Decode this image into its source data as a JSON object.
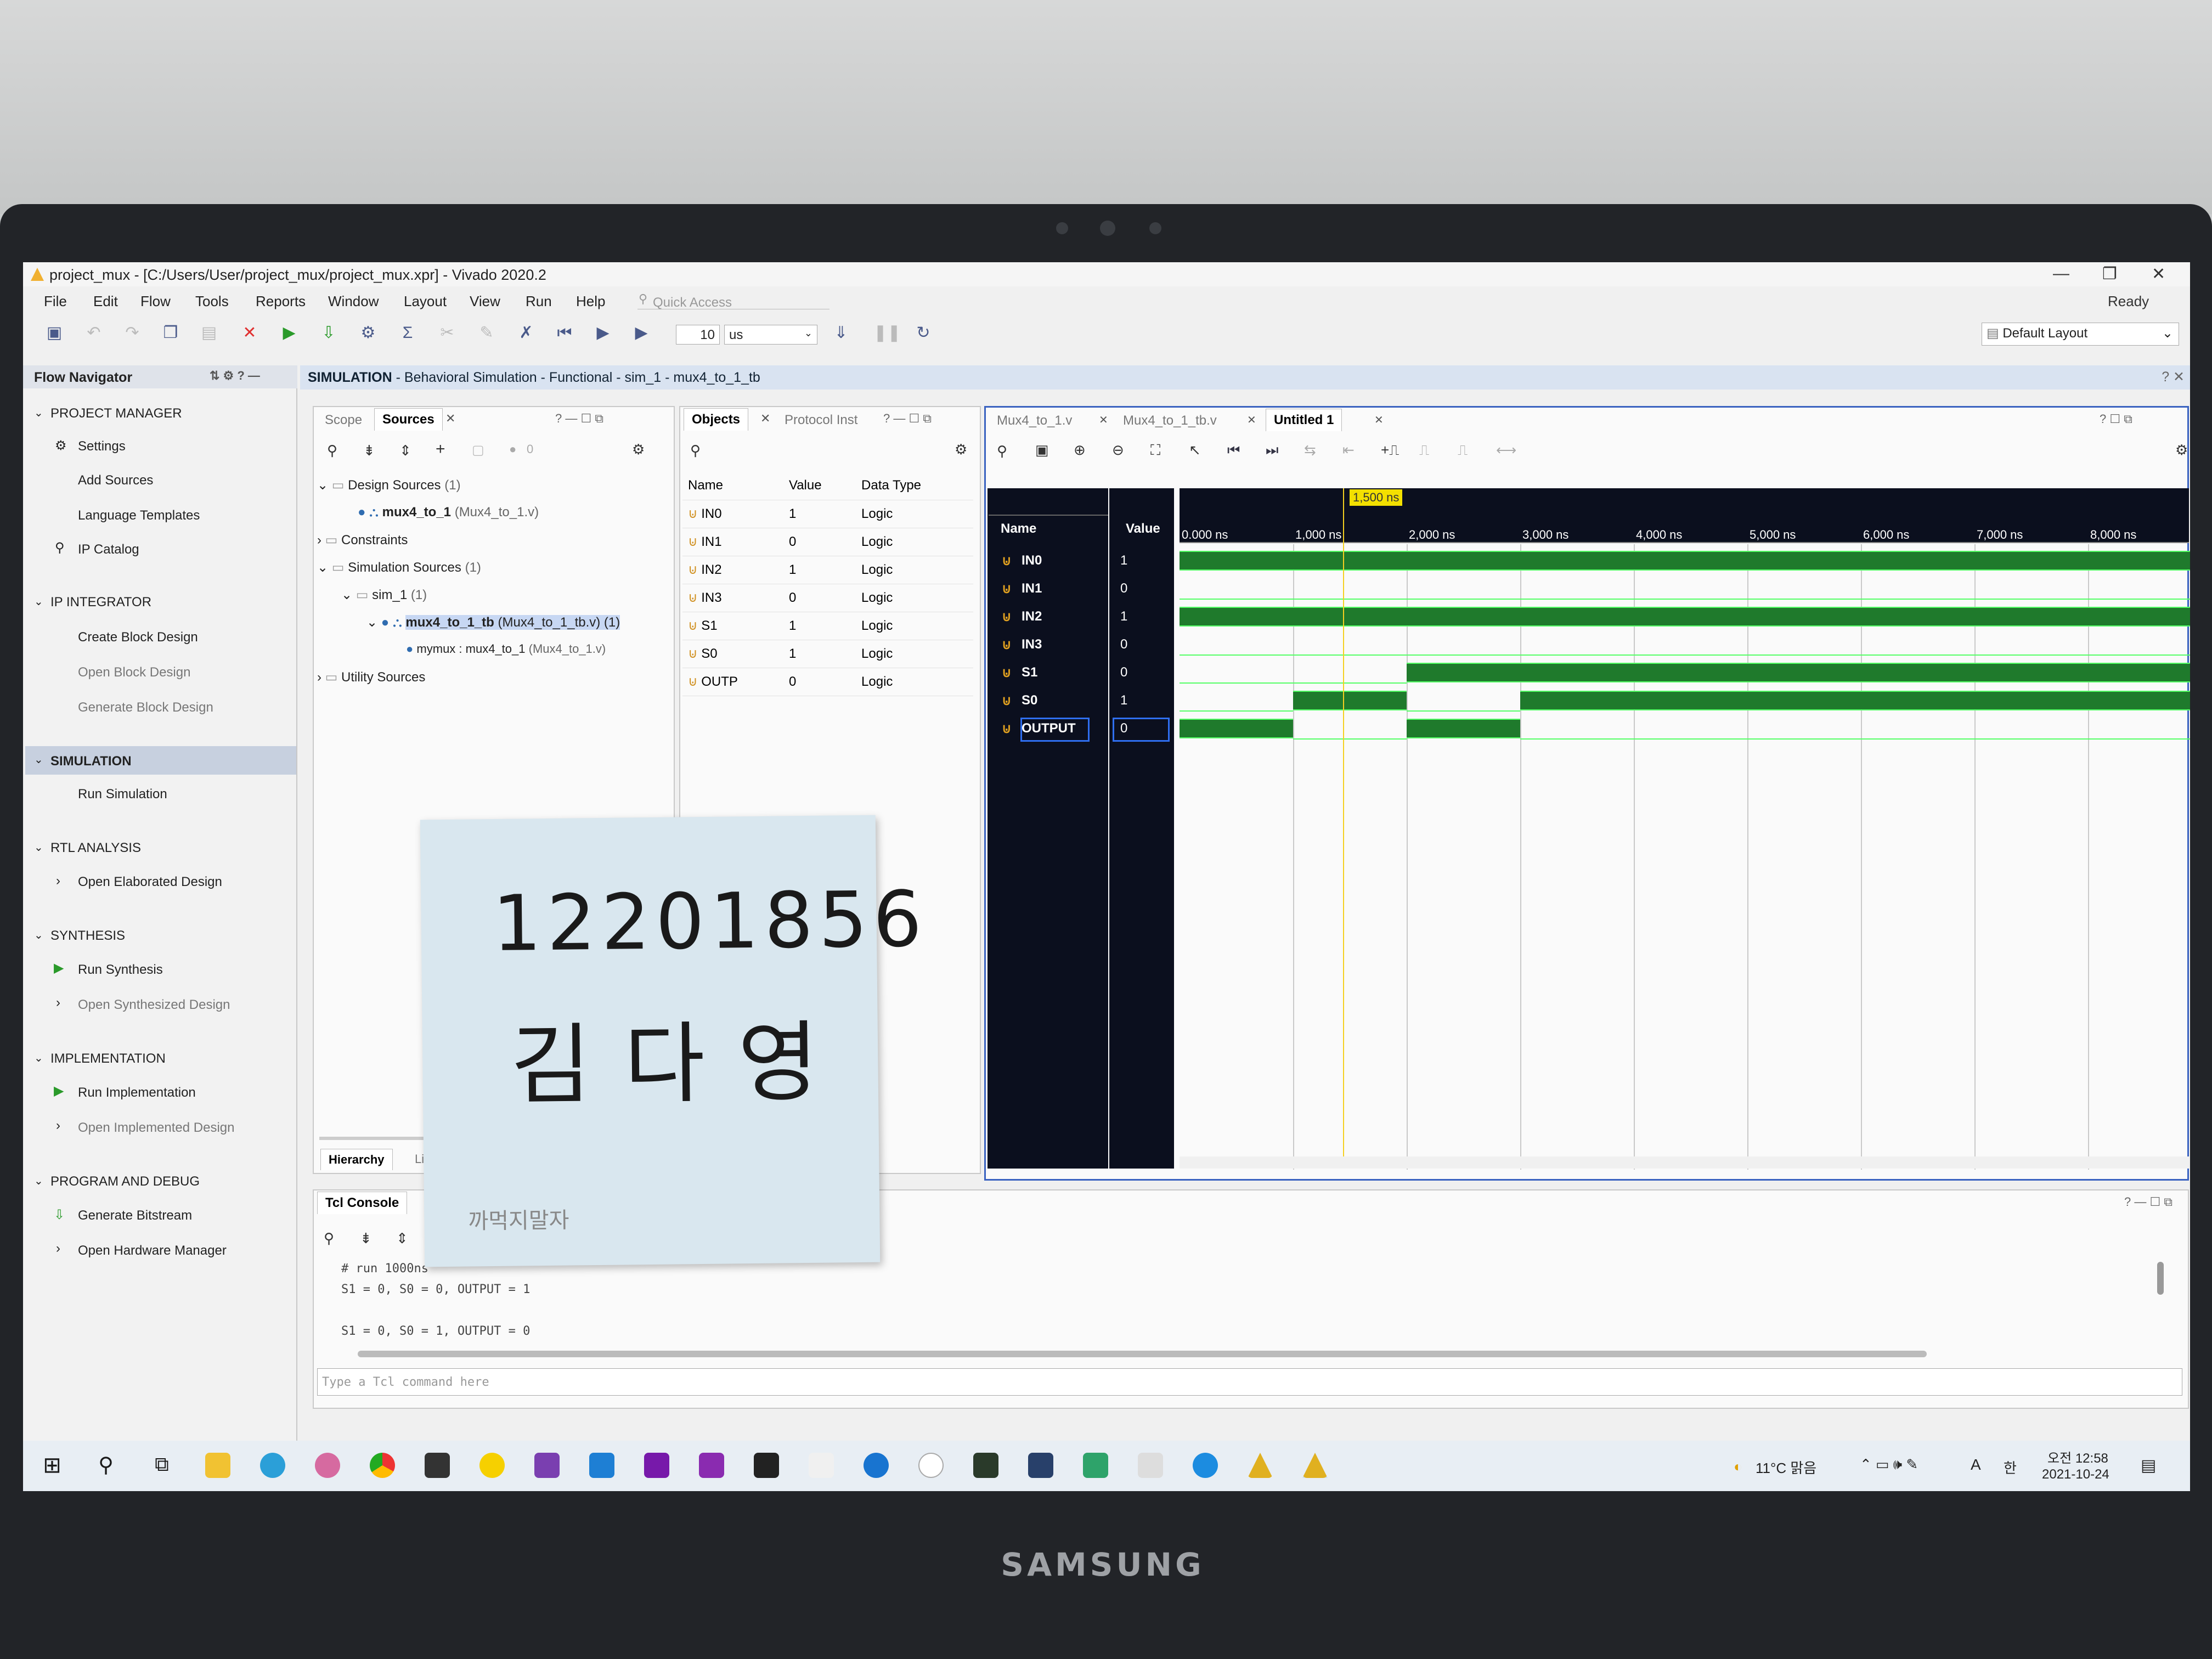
{
  "window": {
    "title": "project_mux - [C:/Users/User/project_mux/project_mux.xpr] - Vivado 2020.2",
    "status": "Ready",
    "controls": [
      "—",
      "❐",
      "✕"
    ]
  },
  "menu": [
    "File",
    "Edit",
    "Flow",
    "Tools",
    "Reports",
    "Window",
    "Layout",
    "View",
    "Run",
    "Help"
  ],
  "quick_access_placeholder": "Quick Access",
  "toolbar": {
    "run_time_value": "10",
    "run_time_unit": "us",
    "layout_select": "Default Layout"
  },
  "flow_navigator": {
    "title": "Flow Navigator",
    "sections": [
      {
        "label": "PROJECT MANAGER",
        "items": [
          "Settings",
          "Add Sources",
          "Language Templates",
          "IP Catalog"
        ]
      },
      {
        "label": "IP INTEGRATOR",
        "items": [
          "Create Block Design",
          "Open Block Design",
          "Generate Block Design"
        ]
      },
      {
        "label": "SIMULATION",
        "items": [
          "Run Simulation"
        ]
      },
      {
        "label": "RTL ANALYSIS",
        "items": [
          "Open Elaborated Design"
        ]
      },
      {
        "label": "SYNTHESIS",
        "items": [
          "Run Synthesis",
          "Open Synthesized Design"
        ]
      },
      {
        "label": "IMPLEMENTATION",
        "items": [
          "Run Implementation",
          "Open Implemented Design"
        ]
      },
      {
        "label": "PROGRAM AND DEBUG",
        "items": [
          "Generate Bitstream",
          "Open Hardware Manager"
        ]
      }
    ]
  },
  "sim_banner": {
    "bold": "SIMULATION",
    "rest": " - Behavioral Simulation - Functional - sim_1 - mux4_to_1_tb"
  },
  "sources_panel": {
    "tabs": [
      "Scope",
      "Sources"
    ],
    "bottom_tabs": [
      "Hierarchy",
      "Li"
    ],
    "count_badge": "0",
    "tree": [
      {
        "label": "Design Sources",
        "meta": " (1)"
      },
      {
        "label": "mux4_to_1",
        "meta": " (Mux4_to_1.v)"
      },
      {
        "label": "Constraints",
        "meta": ""
      },
      {
        "label": "Simulation Sources",
        "meta": " (1)"
      },
      {
        "label": "sim_1",
        "meta": " (1)"
      },
      {
        "label": "mux4_to_1_tb",
        "meta": " (Mux4_to_1_tb.v) (1)"
      },
      {
        "label": "mymux : mux4_to_1",
        "meta": " (Mux4_to_1.v)"
      },
      {
        "label": "Utility Sources",
        "meta": ""
      }
    ]
  },
  "objects_panel": {
    "tabs": [
      "Objects",
      "Protocol Inst"
    ],
    "columns": [
      "Name",
      "Value",
      "Data Type"
    ],
    "rows": [
      {
        "name": "IN0",
        "value": "1",
        "type": "Logic"
      },
      {
        "name": "IN1",
        "value": "0",
        "type": "Logic"
      },
      {
        "name": "IN2",
        "value": "1",
        "type": "Logic"
      },
      {
        "name": "IN3",
        "value": "0",
        "type": "Logic"
      },
      {
        "name": "S1",
        "value": "1",
        "type": "Logic"
      },
      {
        "name": "S0",
        "value": "1",
        "type": "Logic"
      },
      {
        "name": "OUTP",
        "value": "0",
        "type": "Logic"
      }
    ]
  },
  "wave_panel": {
    "tabs": [
      "Mux4_to_1.v",
      "Mux4_to_1_tb.v",
      "Untitled 1"
    ],
    "name_header": "Name",
    "value_header": "Value",
    "cursor_label": "1,500 ns",
    "tick_labels": [
      "0.000 ns",
      "1,000 ns",
      "2,000 ns",
      "3,000 ns",
      "4,000 ns",
      "5,000 ns",
      "6,000 ns",
      "7,000 ns",
      "8,000 ns"
    ],
    "signals": [
      {
        "name": "IN0",
        "value": "1"
      },
      {
        "name": "IN1",
        "value": "0"
      },
      {
        "name": "IN2",
        "value": "1"
      },
      {
        "name": "IN3",
        "value": "0"
      },
      {
        "name": "S1",
        "value": "0"
      },
      {
        "name": "S0",
        "value": "1"
      },
      {
        "name": "OUTPUT",
        "value": "0"
      }
    ]
  },
  "tcl_console": {
    "tab": "Tcl Console",
    "lines": [
      "# run 1000ns",
      "S1 = 0, S0 = 0, OUTPUT = 1",
      "",
      "S1 = 0, S0 = 1, OUTPUT = 0"
    ],
    "input_placeholder": "Type a Tcl command here"
  },
  "taskbar": {
    "weather": "11°C 맑음",
    "time": "오전 12:58",
    "date": "2021-10-24",
    "ime": "A",
    "lang": "한"
  },
  "sticky_note": {
    "number": "12201856",
    "name": "김다영",
    "brand": "까먹지말자"
  },
  "laptop_brand": "SAMSUNG",
  "colors": {
    "wave_bg": "#0b0f1e",
    "wave_high": "#55ff66",
    "cursor": "#f5d020",
    "selection": "#c7d0df"
  }
}
